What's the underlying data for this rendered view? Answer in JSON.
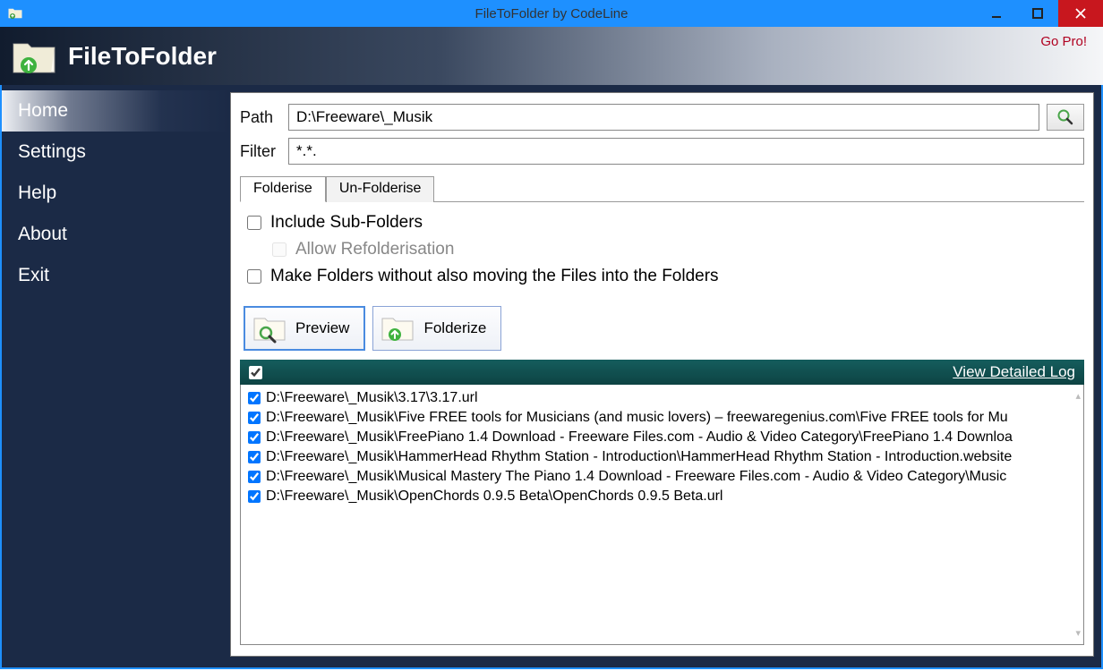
{
  "window": {
    "title": "FileToFolder by CodeLine"
  },
  "header": {
    "app_name": "FileToFolder",
    "gopro": "Go Pro!"
  },
  "sidebar": {
    "items": [
      {
        "label": "Home",
        "active": true
      },
      {
        "label": "Settings",
        "active": false
      },
      {
        "label": "Help",
        "active": false
      },
      {
        "label": "About",
        "active": false
      },
      {
        "label": "Exit",
        "active": false
      }
    ]
  },
  "form": {
    "path_label": "Path",
    "path_value": "D:\\Freeware\\_Musik",
    "filter_label": "Filter",
    "filter_value": "*.*."
  },
  "tabs": {
    "items": [
      {
        "label": "Folderise",
        "active": true
      },
      {
        "label": "Un-Folderise",
        "active": false
      }
    ]
  },
  "options": {
    "include_sub": "Include Sub-Folders",
    "allow_refold": "Allow Refolderisation",
    "make_without_move": "Make Folders without also moving the Files into the Folders"
  },
  "actions": {
    "preview": "Preview",
    "folderize": "Folderize"
  },
  "list": {
    "view_log": "View Detailed Log",
    "items": [
      "D:\\Freeware\\_Musik\\3.17\\3.17.url",
      "D:\\Freeware\\_Musik\\Five FREE tools for Musicians (and music lovers) – freewaregenius.com\\Five FREE tools for Mu",
      "D:\\Freeware\\_Musik\\FreePiano 1.4 Download - Freeware Files.com - Audio & Video Category\\FreePiano 1.4 Downloa",
      "D:\\Freeware\\_Musik\\HammerHead Rhythm Station - Introduction\\HammerHead Rhythm Station - Introduction.website",
      "D:\\Freeware\\_Musik\\Musical Mastery The Piano 1.4 Download - Freeware Files.com - Audio & Video Category\\Music",
      "D:\\Freeware\\_Musik\\OpenChords 0.9.5 Beta\\OpenChords 0.9.5 Beta.url"
    ]
  }
}
